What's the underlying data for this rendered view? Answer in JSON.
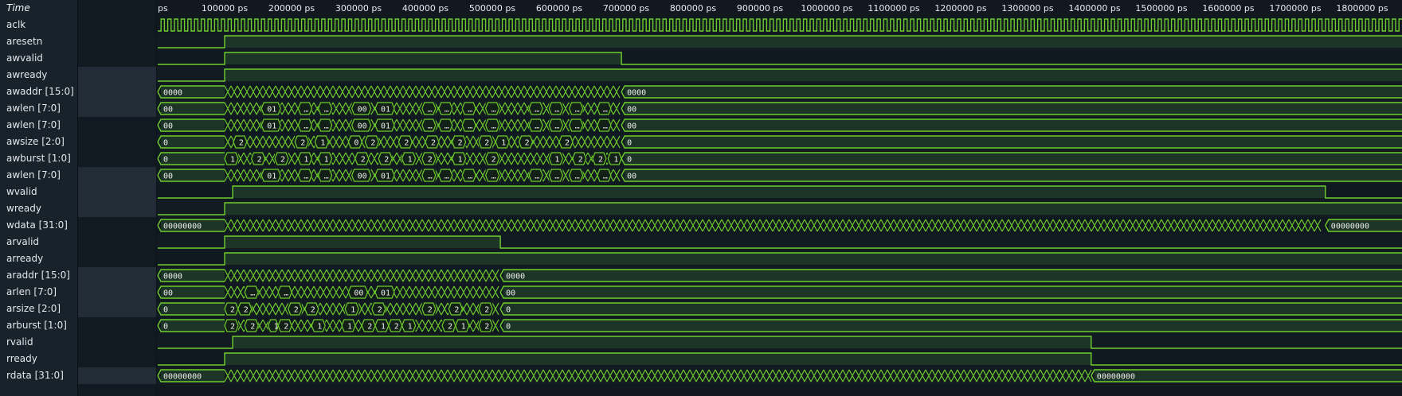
{
  "time_axis": {
    "label": "Time",
    "ticks": [
      "ps",
      "100000 ps",
      "200000 ps",
      "300000 ps",
      "400000 ps",
      "500000 ps",
      "600000 ps",
      "700000 ps",
      "800000 ps",
      "900000 ps",
      "1000000 ps",
      "1100000 ps",
      "1200000 ps",
      "1300000 ps",
      "1400000 ps",
      "1500000 ps",
      "1600000 ps",
      "1700000 ps",
      "1800000 ps"
    ]
  },
  "colors": {
    "wave": "#6fcd2c",
    "fill": "#1d3526",
    "bus_text": "#f0f0f0",
    "background": "#111820"
  },
  "signals": [
    {
      "name": "aclk",
      "type": "clock",
      "highlight": false
    },
    {
      "name": "aresetn",
      "type": "bit",
      "highlight": false,
      "events": [
        [
          0,
          0
        ],
        [
          100000,
          1
        ]
      ]
    },
    {
      "name": "awvalid",
      "type": "bit",
      "highlight": false,
      "events": [
        [
          0,
          0
        ],
        [
          100000,
          1
        ],
        [
          693000,
          0
        ]
      ]
    },
    {
      "name": "awready",
      "type": "bit",
      "highlight": true,
      "events": [
        [
          0,
          0
        ],
        [
          100000,
          1
        ]
      ]
    },
    {
      "name": "awaddr [15:0]",
      "type": "bus",
      "highlight": true,
      "labels": [
        [
          0,
          "0000"
        ],
        [
          693000,
          "0000"
        ]
      ],
      "toggle": [
        100000,
        693000
      ]
    },
    {
      "name": "awlen [7:0]",
      "type": "bus",
      "highlight": true,
      "labels": [
        [
          0,
          "00"
        ],
        [
          155000,
          "01"
        ],
        [
          210000,
          "…"
        ],
        [
          240000,
          "…"
        ],
        [
          290000,
          "00"
        ],
        [
          325000,
          "01"
        ],
        [
          395000,
          "…"
        ],
        [
          420000,
          "…"
        ],
        [
          455000,
          "…"
        ],
        [
          490000,
          "…"
        ],
        [
          555000,
          "…"
        ],
        [
          585000,
          "…"
        ],
        [
          615000,
          "…"
        ],
        [
          657000,
          "…"
        ],
        [
          693000,
          "00"
        ]
      ],
      "toggle": [
        100000,
        693000
      ]
    },
    {
      "name": "awlen [7:0]",
      "type": "bus",
      "highlight": false,
      "labels": [
        [
          0,
          "00"
        ],
        [
          155000,
          "01"
        ],
        [
          210000,
          "…"
        ],
        [
          240000,
          "…"
        ],
        [
          290000,
          "00"
        ],
        [
          325000,
          "01"
        ],
        [
          395000,
          "…"
        ],
        [
          420000,
          "…"
        ],
        [
          455000,
          "…"
        ],
        [
          490000,
          "…"
        ],
        [
          555000,
          "…"
        ],
        [
          585000,
          "…"
        ],
        [
          615000,
          "…"
        ],
        [
          657000,
          "…"
        ],
        [
          693000,
          "00"
        ]
      ],
      "toggle": [
        100000,
        693000
      ]
    },
    {
      "name": "awsize [2:0]",
      "type": "bus",
      "highlight": false,
      "labels": [
        [
          0,
          "0"
        ],
        [
          113000,
          "2"
        ],
        [
          205000,
          "2"
        ],
        [
          235000,
          "1"
        ],
        [
          285000,
          "0"
        ],
        [
          310000,
          "2"
        ],
        [
          360000,
          "2"
        ],
        [
          400000,
          "2"
        ],
        [
          440000,
          "2"
        ],
        [
          480000,
          "2"
        ],
        [
          505000,
          "1"
        ],
        [
          540000,
          "2"
        ],
        [
          600000,
          "2"
        ],
        [
          693000,
          "0"
        ]
      ],
      "toggle": [
        100000,
        693000
      ]
    },
    {
      "name": "awburst [1:0]",
      "type": "bus",
      "highlight": false,
      "labels": [
        [
          0,
          "0"
        ],
        [
          100000,
          "1"
        ],
        [
          140000,
          "2"
        ],
        [
          175000,
          "2"
        ],
        [
          210000,
          "1"
        ],
        [
          240000,
          "1"
        ],
        [
          295000,
          "2"
        ],
        [
          330000,
          "2"
        ],
        [
          365000,
          "1"
        ],
        [
          395000,
          "2"
        ],
        [
          440000,
          "1"
        ],
        [
          490000,
          "2"
        ],
        [
          585000,
          "1"
        ],
        [
          620000,
          "2"
        ],
        [
          650000,
          "2"
        ],
        [
          673000,
          "1"
        ],
        [
          693000,
          "0"
        ]
      ],
      "toggle": [
        100000,
        693000
      ]
    },
    {
      "name": "awlen [7:0]",
      "type": "bus",
      "highlight": true,
      "labels": [
        [
          0,
          "00"
        ],
        [
          155000,
          "01"
        ],
        [
          210000,
          "…"
        ],
        [
          240000,
          "…"
        ],
        [
          290000,
          "00"
        ],
        [
          325000,
          "01"
        ],
        [
          395000,
          "…"
        ],
        [
          420000,
          "…"
        ],
        [
          455000,
          "…"
        ],
        [
          490000,
          "…"
        ],
        [
          555000,
          "…"
        ],
        [
          585000,
          "…"
        ],
        [
          615000,
          "…"
        ],
        [
          657000,
          "…"
        ],
        [
          693000,
          "00"
        ]
      ],
      "toggle": [
        100000,
        693000
      ]
    },
    {
      "name": "wvalid",
      "type": "bit",
      "highlight": true,
      "events": [
        [
          0,
          0
        ],
        [
          112000,
          1
        ],
        [
          1745000,
          0
        ]
      ]
    },
    {
      "name": "wready",
      "type": "bit",
      "highlight": true,
      "events": [
        [
          0,
          0
        ],
        [
          100000,
          1
        ]
      ]
    },
    {
      "name": "wdata [31:0]",
      "type": "bus",
      "highlight": false,
      "labels": [
        [
          0,
          "00000000"
        ],
        [
          1745000,
          "00000000"
        ]
      ],
      "toggle": [
        100000,
        1745000
      ]
    },
    {
      "name": "arvalid",
      "type": "bit",
      "highlight": false,
      "events": [
        [
          0,
          0
        ],
        [
          100000,
          1
        ],
        [
          512000,
          0
        ]
      ]
    },
    {
      "name": "arready",
      "type": "bit",
      "highlight": false,
      "events": [
        [
          0,
          0
        ],
        [
          100000,
          1
        ]
      ]
    },
    {
      "name": "araddr [15:0]",
      "type": "bus",
      "highlight": true,
      "labels": [
        [
          0,
          "0000"
        ],
        [
          512000,
          "0000"
        ]
      ],
      "toggle": [
        100000,
        512000
      ]
    },
    {
      "name": "arlen [7:0]",
      "type": "bus",
      "highlight": true,
      "labels": [
        [
          0,
          "00"
        ],
        [
          130000,
          "…"
        ],
        [
          180000,
          "…"
        ],
        [
          285000,
          "00"
        ],
        [
          325000,
          "01"
        ],
        [
          512000,
          "00"
        ]
      ],
      "toggle": [
        100000,
        512000
      ]
    },
    {
      "name": "arsize [2:0]",
      "type": "bus",
      "highlight": true,
      "labels": [
        [
          0,
          "0"
        ],
        [
          100000,
          "2"
        ],
        [
          120000,
          "2"
        ],
        [
          195000,
          "2"
        ],
        [
          220000,
          "2"
        ],
        [
          280000,
          "1"
        ],
        [
          320000,
          "2"
        ],
        [
          395000,
          "2"
        ],
        [
          435000,
          "2"
        ],
        [
          480000,
          "2"
        ],
        [
          512000,
          "0"
        ]
      ],
      "toggle": [
        100000,
        512000
      ]
    },
    {
      "name": "arburst [1:0]",
      "type": "bus",
      "highlight": false,
      "labels": [
        [
          0,
          "0"
        ],
        [
          100000,
          "2"
        ],
        [
          130000,
          "2"
        ],
        [
          165000,
          "1"
        ],
        [
          180000,
          "2"
        ],
        [
          230000,
          "1"
        ],
        [
          275000,
          "1"
        ],
        [
          305000,
          "2"
        ],
        [
          325000,
          "1"
        ],
        [
          345000,
          "2"
        ],
        [
          365000,
          "1"
        ],
        [
          425000,
          "2"
        ],
        [
          445000,
          "1"
        ],
        [
          480000,
          "2"
        ],
        [
          512000,
          "0"
        ]
      ],
      "toggle": [
        100000,
        512000
      ]
    },
    {
      "name": "rvalid",
      "type": "bit",
      "highlight": false,
      "events": [
        [
          0,
          0
        ],
        [
          112000,
          1
        ],
        [
          1395000,
          0
        ]
      ]
    },
    {
      "name": "rready",
      "type": "bit",
      "highlight": false,
      "events": [
        [
          0,
          0
        ],
        [
          100000,
          1
        ],
        [
          1395000,
          0
        ]
      ]
    },
    {
      "name": "rdata [31:0]",
      "type": "bus",
      "highlight": true,
      "labels": [
        [
          0,
          "00000000"
        ],
        [
          1395000,
          "00000000"
        ]
      ],
      "toggle": [
        100000,
        1395000
      ]
    }
  ]
}
